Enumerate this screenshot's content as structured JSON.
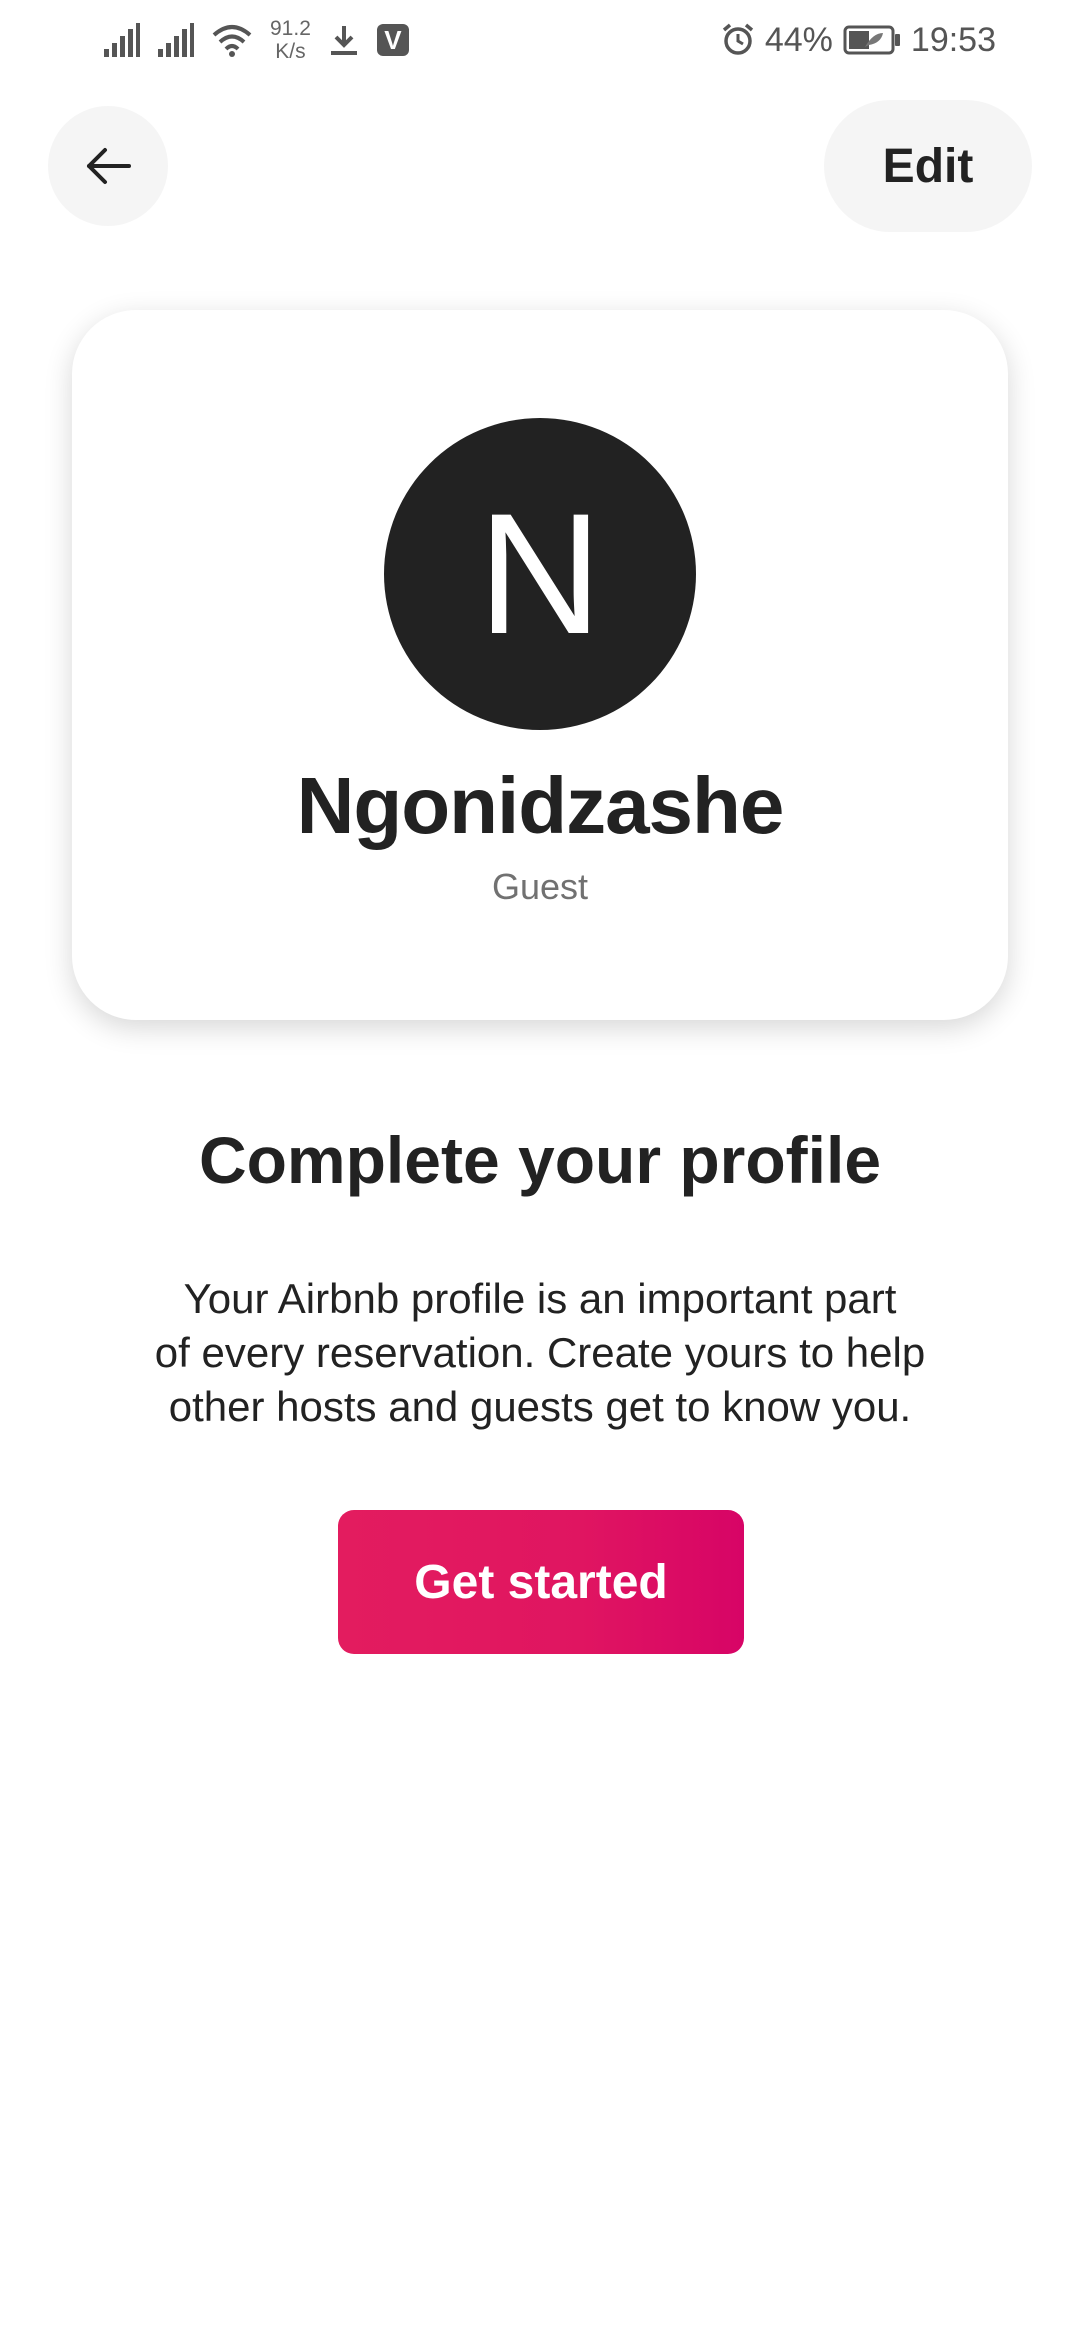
{
  "status_bar": {
    "network_speed_value": "91.2",
    "network_speed_unit": "K/s",
    "app_badge": "V",
    "battery_percent": "44%",
    "time": "19:53"
  },
  "header": {
    "back_icon": "arrow-left-icon",
    "edit_label": "Edit"
  },
  "profile": {
    "avatar_initial": "N",
    "name": "Ngonidzashe",
    "role": "Guest"
  },
  "complete_profile": {
    "title": "Complete your profile",
    "line1": "Your Airbnb profile is an important part",
    "line2": "of every reservation. Create yours to help",
    "line3": "other hosts and guests get to know you.",
    "button_label": "Get started"
  },
  "colors": {
    "accent_start": "#e31c5f",
    "accent_end": "#d70466",
    "avatar_bg": "#222222",
    "text_primary": "#222222",
    "text_secondary": "#717171"
  }
}
